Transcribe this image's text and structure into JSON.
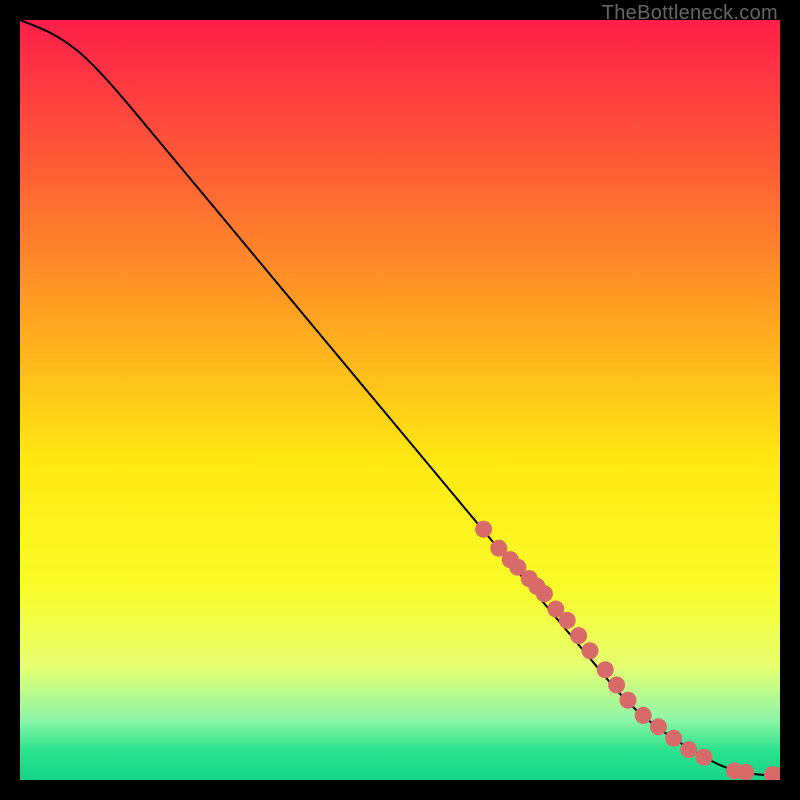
{
  "watermark": "TheBottleneck.com",
  "chart_data": {
    "type": "line",
    "title": "",
    "xlabel": "",
    "ylabel": "",
    "xlim": [
      0,
      100
    ],
    "ylim": [
      0,
      100
    ],
    "line": {
      "x": [
        0,
        5,
        10,
        20,
        30,
        40,
        50,
        60,
        65,
        70,
        75,
        80,
        85,
        90,
        93,
        96,
        100
      ],
      "y": [
        100,
        98,
        94,
        82,
        70,
        58,
        46,
        34,
        28,
        22,
        16,
        10,
        6,
        3,
        1.5,
        0.8,
        0.5
      ]
    },
    "markers": {
      "x": [
        61,
        63,
        64.5,
        65.5,
        67,
        68,
        69,
        70.5,
        72,
        73.5,
        75,
        77,
        78.5,
        80,
        82,
        84,
        86,
        88,
        90,
        94,
        95.5,
        99,
        100
      ],
      "y": [
        33,
        30.5,
        29,
        28,
        26.5,
        25.5,
        24.5,
        22.5,
        21,
        19,
        17,
        14.5,
        12.5,
        10.5,
        8.5,
        7,
        5.5,
        4,
        3,
        1.2,
        1,
        0.7,
        0.6
      ]
    },
    "gradient_stops": [
      {
        "offset": 0,
        "color": "#ff1e4a"
      },
      {
        "offset": 18,
        "color": "#ff5838"
      },
      {
        "offset": 38,
        "color": "#ff9f22"
      },
      {
        "offset": 58,
        "color": "#ffe812"
      },
      {
        "offset": 75,
        "color": "#f8fc2a"
      },
      {
        "offset": 85,
        "color": "#e6ff70"
      },
      {
        "offset": 92,
        "color": "#8ff5a8"
      },
      {
        "offset": 96,
        "color": "#2de38f"
      },
      {
        "offset": 100,
        "color": "#14d487"
      }
    ],
    "marker_color": "#d86a6a",
    "line_color": "#000000"
  }
}
